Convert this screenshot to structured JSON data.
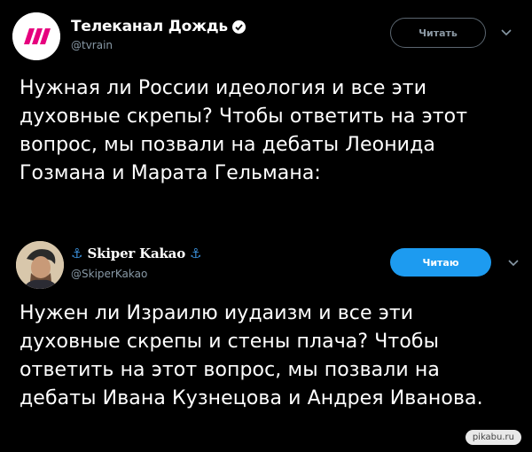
{
  "tweets": [
    {
      "display_name": "Телеканал Дождь",
      "handle": "@tvrain",
      "follow_label": "Читать",
      "text": "Нужная ли России идеология и все эти духовные скрепы? Чтобы ответить на этот вопрос, мы позвали на дебаты Леонида Гозмана и Марата Гельмана:"
    },
    {
      "display_name": "Skiper Kakao",
      "handle": "@SkiperKakao",
      "follow_label": "Читаю",
      "text": "Нужен ли Израилю иудаизм и все эти духовные скрепы и стены плача? Чтобы ответить на этот вопрос, мы позвали на дебаты Ивана Кузнецова и Андрея Иванова."
    }
  ],
  "watermark": "pikabu.ru",
  "colors": {
    "background": "#000000",
    "text": "#ffffff",
    "muted": "#8899a6",
    "accent": "#1d9bf0",
    "brand_tvrain": "#e6007e"
  }
}
